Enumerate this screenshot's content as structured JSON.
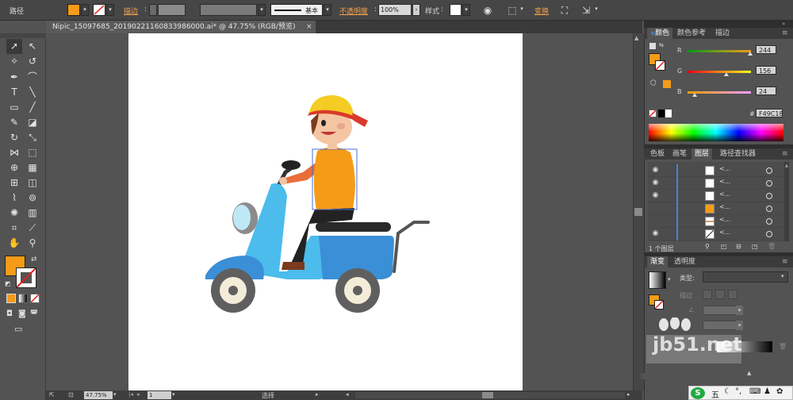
{
  "control_bar": {
    "path_label": "路径",
    "stroke_label": "描边",
    "brush_label": "基本",
    "opacity_label": "不透明度",
    "opacity_value": "100%",
    "style_label": "样式",
    "transform_label": "变换",
    "fill_color": "#F49C18"
  },
  "document": {
    "tab_title": "Nipic_15097685_20190221160833986000.ai* @ 47.75% (RGB/预览)",
    "close_glyph": "×"
  },
  "status_bar": {
    "zoom": "47.75%",
    "page": "1",
    "tool": "选择"
  },
  "color_panel": {
    "tabs": [
      "颜色",
      "颜色参考",
      "描边"
    ],
    "r_label": "R",
    "g_label": "G",
    "b_label": "B",
    "r_value": "244",
    "g_value": "156",
    "b_value": "24",
    "hash": "#",
    "hex_value": "F49C18"
  },
  "layers_panel": {
    "tabs": [
      "色板",
      "画笔",
      "图层",
      "路径查找器"
    ],
    "rows": [
      {
        "name": "<...",
        "visible": true
      },
      {
        "name": "<...",
        "visible": true
      },
      {
        "name": "<...",
        "visible": true
      },
      {
        "name": "<...",
        "visible": false
      },
      {
        "name": "<...",
        "visible": false
      },
      {
        "name": "<...",
        "visible": true
      }
    ],
    "footer_text": "1 个图层"
  },
  "gradient_panel": {
    "tabs": [
      "渐变",
      "透明度"
    ],
    "type_label": "类型:",
    "stroke_label": "描边"
  },
  "watermark_text": "jb51.net",
  "ime": {
    "logo": "S",
    "label": "五"
  }
}
